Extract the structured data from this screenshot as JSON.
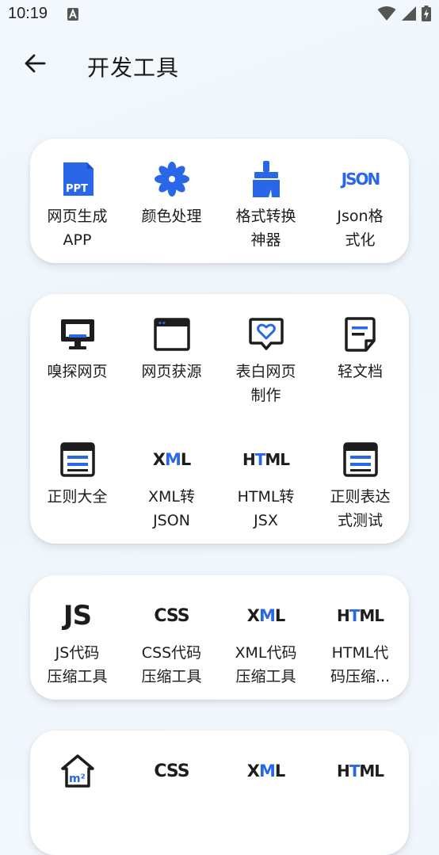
{
  "status": {
    "time": "10:19"
  },
  "header": {
    "title": "开发工具"
  },
  "icons": {
    "ppt": "PPT",
    "json": "JSON",
    "js": "JS",
    "css": "CSS",
    "xml_x": "X",
    "xml_m": "M",
    "xml_l": "L",
    "html_h": "H",
    "html_t": "T",
    "html_ml": "ML",
    "m2": "m²"
  },
  "colors": {
    "accent": "#2a67e8",
    "dark": "#1d1d1d"
  },
  "cards": [
    {
      "items": [
        {
          "label": "网页生成\nAPP",
          "icon": "ppt-icon"
        },
        {
          "label": "颜色处理",
          "icon": "flower-icon"
        },
        {
          "label": "格式转换\n神器",
          "icon": "brush-icon"
        },
        {
          "label": "Json格\n式化",
          "icon": "json-icon"
        }
      ]
    },
    {
      "items": [
        {
          "label": "嗅探网页",
          "icon": "monitor-icon"
        },
        {
          "label": "网页获源",
          "icon": "browser-window-icon"
        },
        {
          "label": "表白网页\n制作",
          "icon": "heart-message-icon"
        },
        {
          "label": "轻文档",
          "icon": "document-icon"
        },
        {
          "label": "正则大全",
          "icon": "regex-card-icon"
        },
        {
          "label": "XML转\nJSON",
          "icon": "xml-icon"
        },
        {
          "label": "HTML转\nJSX",
          "icon": "html-icon"
        },
        {
          "label": "正则表达\n式测试",
          "icon": "regex-test-icon"
        }
      ]
    },
    {
      "items": [
        {
          "label": "JS代码\n压缩工具",
          "icon": "js-icon"
        },
        {
          "label": "CSS代码\n压缩工具",
          "icon": "css-icon"
        },
        {
          "label": "XML代码\n压缩工具",
          "icon": "xml-icon"
        },
        {
          "label": "HTML代\n码压缩...",
          "icon": "html-icon"
        }
      ]
    }
  ]
}
